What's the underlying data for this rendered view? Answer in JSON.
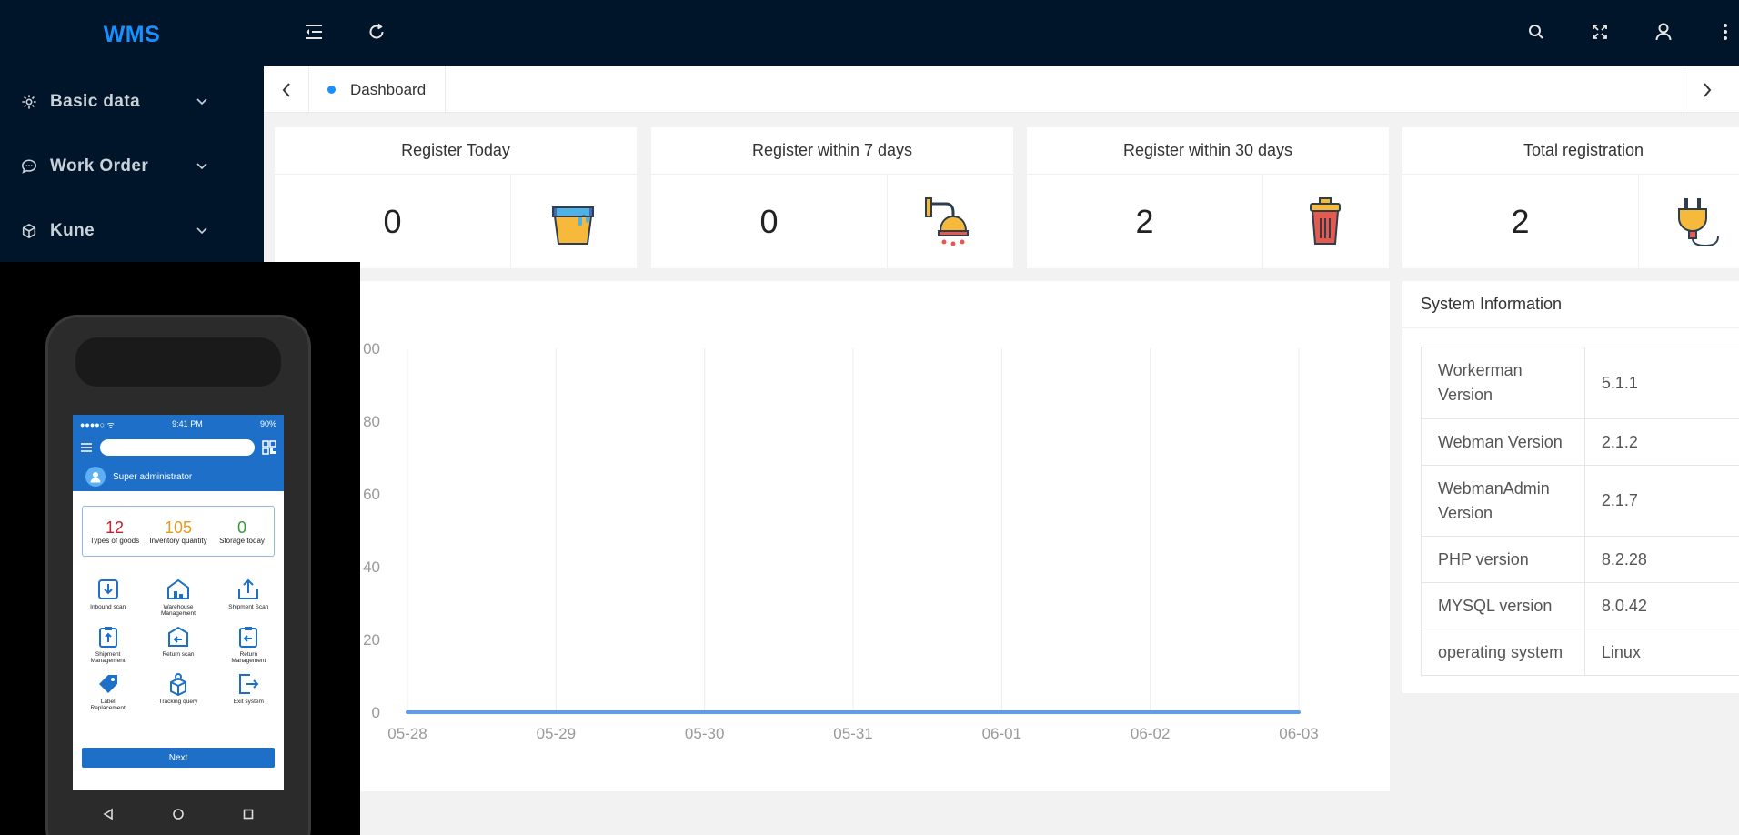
{
  "app": {
    "logo": "WMS"
  },
  "sidebar": {
    "items": [
      {
        "label": "Basic data",
        "icon": "gear-icon"
      },
      {
        "label": "Work Order",
        "icon": "chat-icon"
      },
      {
        "label": "Kune",
        "icon": "cube-icon"
      }
    ]
  },
  "header": {
    "icons": [
      "collapse-menu-icon",
      "refresh-icon",
      "search-icon",
      "fullscreen-icon",
      "user-icon",
      "more-vertical-icon"
    ]
  },
  "tabs": [
    {
      "label": "Dashboard",
      "active": true
    }
  ],
  "cards": [
    {
      "title": "Register Today",
      "value": "0",
      "icon": "paint-bucket-icon"
    },
    {
      "title": "Register within 7 days",
      "value": "0",
      "icon": "shower-icon"
    },
    {
      "title": "Register within 30 days",
      "value": "2",
      "icon": "trash-can-icon"
    },
    {
      "title": "Total registration",
      "value": "2",
      "icon": "plug-icon"
    }
  ],
  "chart_data": {
    "type": "line",
    "categories": [
      "05-28",
      "05-29",
      "05-30",
      "05-31",
      "06-01",
      "06-02",
      "06-03"
    ],
    "series": [
      {
        "values": [
          0,
          0,
          0,
          0,
          0,
          0,
          0
        ],
        "color": "#5b9ef0"
      }
    ],
    "yticks": [
      "00",
      "80",
      "60",
      "40",
      "20",
      "0"
    ],
    "ylim": [
      0,
      100
    ],
    "grid": "vertical"
  },
  "system_info": {
    "title": "System Information",
    "rows": [
      {
        "key": "Workerman Version",
        "value": "5.1.1"
      },
      {
        "key": "Webman Version",
        "value": "2.1.2"
      },
      {
        "key": "WebmanAdmin Version",
        "value": "2.1.7"
      },
      {
        "key": "PHP version",
        "value": "8.2.28"
      },
      {
        "key": "MYSQL version",
        "value": "8.0.42"
      },
      {
        "key": "operating system",
        "value": "Linux"
      }
    ]
  },
  "phone": {
    "time": "9:41 PM",
    "battery": "90%",
    "user": "Super administrator",
    "stats": [
      {
        "num": "12",
        "label": "Types of goods",
        "color": "#c0272d"
      },
      {
        "num": "105",
        "label": "Inventory quantity",
        "color": "#e89a1c"
      },
      {
        "num": "0",
        "label": "Storage today",
        "color": "#3a9a3a"
      }
    ],
    "grid": [
      {
        "label": "Inbound scan"
      },
      {
        "label": "Warehouse Management"
      },
      {
        "label": "Shipment Scan"
      },
      {
        "label": "Shipment Management"
      },
      {
        "label": "Return scan"
      },
      {
        "label": "Return Management"
      },
      {
        "label": "Label Replacement"
      },
      {
        "label": "Tracking query"
      },
      {
        "label": "Exit system"
      }
    ],
    "next": "Next"
  },
  "colors": {
    "sidebar": "#001529",
    "accent": "#1890ff",
    "phone_blue": "#1e6fc8"
  }
}
